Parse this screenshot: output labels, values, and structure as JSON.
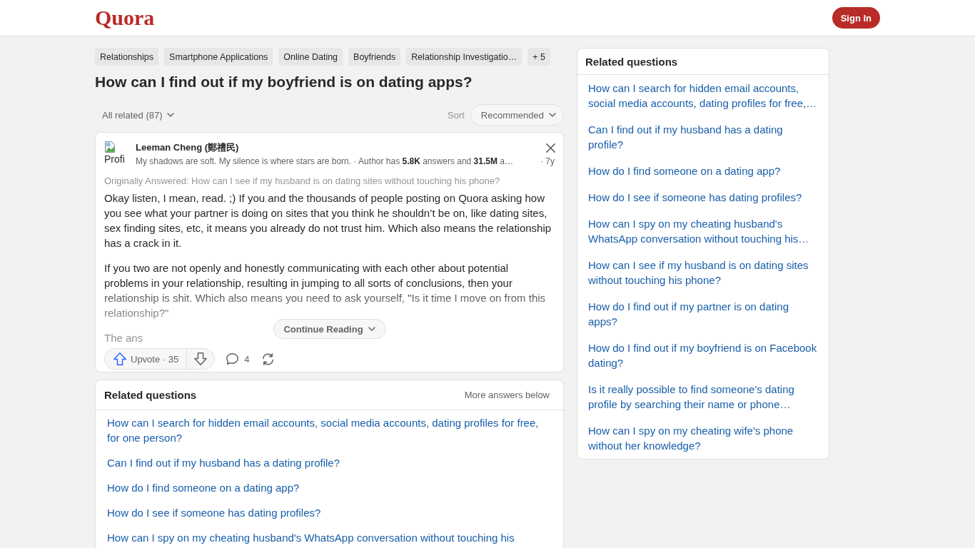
{
  "header": {
    "logo": "Quora",
    "sign_in": "Sign In"
  },
  "topics": [
    "Relationships",
    "Smartphone Applications",
    "Online Dating",
    "Boyfriends",
    "Relationship Investigatio…"
  ],
  "more_topics": "+ 5",
  "question": "How can I find out if my boyfriend is on dating apps?",
  "answers_bar": {
    "filter": "All related (87)",
    "sort_label": "Sort",
    "sort_value": "Recommended"
  },
  "answer": {
    "avatar_alt": "Profi",
    "author": "Leeman Cheng (鄭禮民)",
    "credential": "My shadows are soft. My silence is where stars are born. · Author has **5.8K** answers and **31.5M** a…",
    "age": "· 7y",
    "originally_answered": "Originally Answered: How can I see if my husband is on dating sites without touching his phone?",
    "paragraphs": [
      "Okay listen, I mean, read. ;) If you and the thousands of people posting on Quora asking how you see what your partner is doing on sites that you think he shouldn’t be on, like dating sites, sex finding sites, etc, it means you already do not trust him. Which also means the relationship has a crack in it.",
      "If you two are not openly and honestly communicating with each other about potential problems in your relationship, resulting in jumping to all sorts of conclusions, then your relationship is shit. Which also means you need to ask yourself, \"Is it time I move on from this relationship?\"",
      "The ans"
    ],
    "continue_reading": "Continue Reading",
    "upvote": "Upvote · 35",
    "comments": "4"
  },
  "related_main": {
    "title": "Related questions",
    "note": "More answers below",
    "items": [
      "How can I search for hidden email accounts, social media accounts, dating profiles for free, for one person?",
      "Can I find out if my husband has a dating profile?",
      "How do I find someone on a dating app?",
      "How do I see if someone has dating profiles?",
      "How can I spy on my cheating husband's WhatsApp conversation without touching his"
    ]
  },
  "related_side": {
    "title": "Related questions",
    "items": [
      "How can I search for hidden email accounts, social media accounts, dating profiles for free,…",
      "Can I find out if my husband has a dating profile?",
      "How do I find someone on a dating app?",
      "How do I see if someone has dating profiles?",
      "How can I spy on my cheating husband's WhatsApp conversation without touching his…",
      "How can I see if my husband is on dating sites without touching his phone?",
      "How do I find out if my partner is on dating apps?",
      "How do I find out if my boyfriend is on Facebook dating?",
      "Is it really possible to find someone's dating profile by searching their name or phone…",
      "How can I spy on my cheating wife's phone without her knowledge?"
    ]
  }
}
